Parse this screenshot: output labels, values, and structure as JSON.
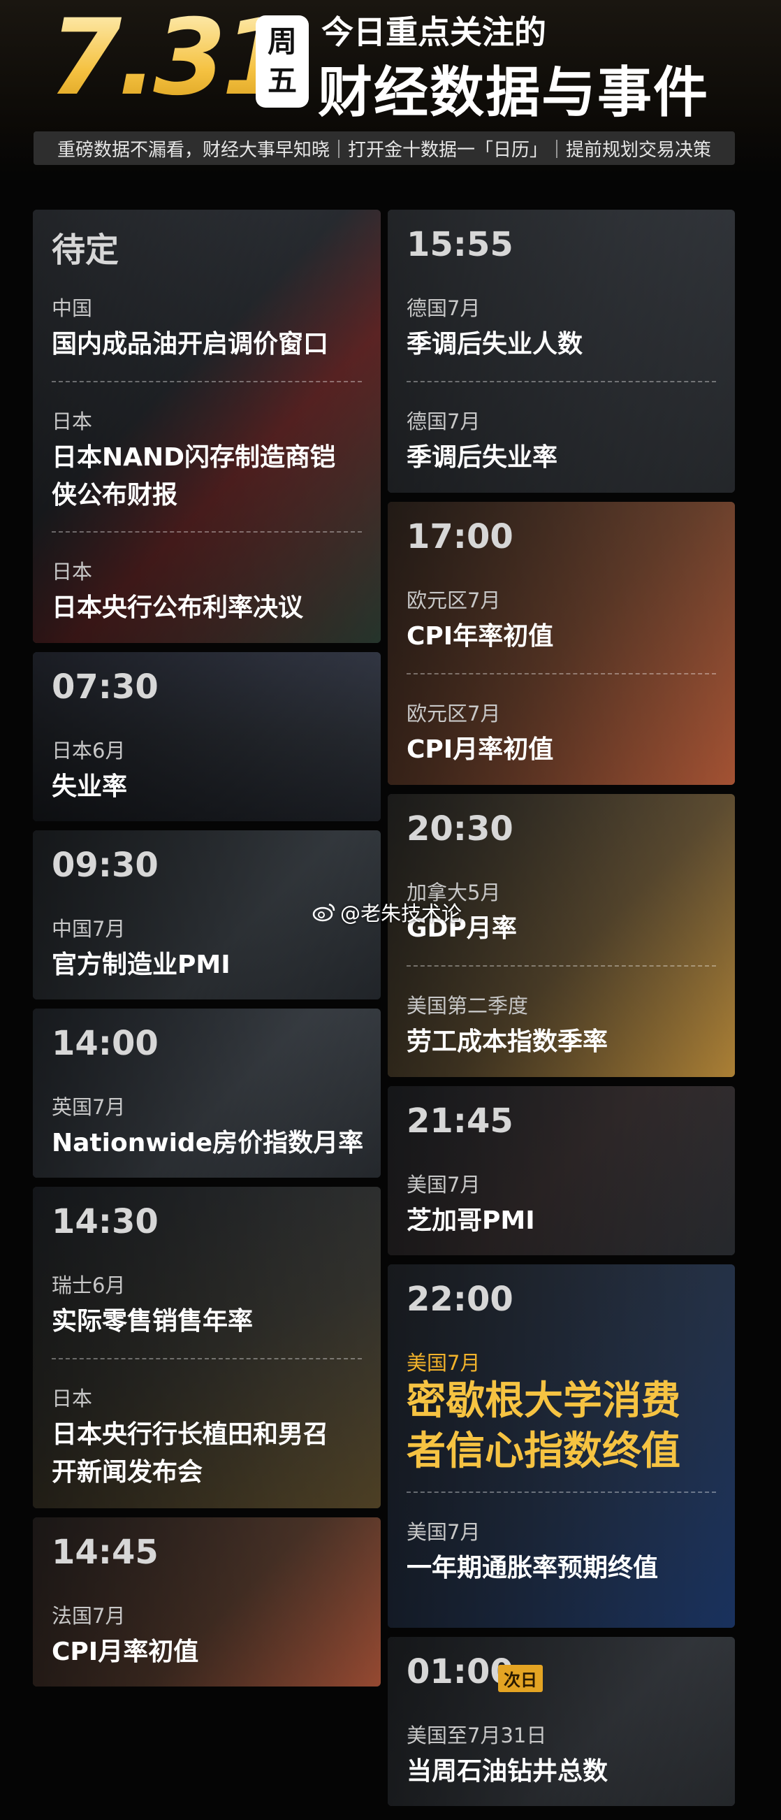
{
  "header": {
    "date": "7.31",
    "weekday": [
      "周",
      "五"
    ],
    "title_line1": "今日重点关注的",
    "title_line2": "财经数据与事件",
    "subtitle": "重磅数据不漏看，财经大事早知晓｜打开金十数据一「日历」｜提前规划交易决策"
  },
  "left": [
    {
      "time": "待定",
      "items": [
        {
          "region": "中国",
          "event": [
            "国内成品油开启调价窗口"
          ]
        },
        {
          "region": "日本",
          "event": [
            "日本NAND闪存制造商铠",
            "侠公布财报"
          ]
        },
        {
          "region": "日本",
          "event": [
            "日本央行公布利率决议"
          ]
        }
      ]
    },
    {
      "time": "07:30",
      "items": [
        {
          "region": "日本6月",
          "event": [
            "失业率"
          ]
        }
      ]
    },
    {
      "time": "09:30",
      "items": [
        {
          "region": "中国7月",
          "event": [
            "官方制造业PMI"
          ]
        }
      ]
    },
    {
      "time": "14:00",
      "items": [
        {
          "region": "英国7月",
          "event": [
            "Nationwide房价指数月率"
          ]
        }
      ]
    },
    {
      "time": "14:30",
      "items": [
        {
          "region": "瑞士6月",
          "event": [
            "实际零售销售年率"
          ]
        },
        {
          "region": "日本",
          "event": [
            "日本央行行长植田和男召",
            "开新闻发布会"
          ]
        }
      ]
    },
    {
      "time": "14:45",
      "items": [
        {
          "region": "法国7月",
          "event": [
            "CPI月率初值"
          ]
        }
      ]
    }
  ],
  "right": [
    {
      "time": "15:55",
      "items": [
        {
          "region": "德国7月",
          "event": [
            "季调后失业人数"
          ]
        },
        {
          "region": "德国7月",
          "event": [
            "季调后失业率"
          ]
        }
      ]
    },
    {
      "time": "17:00",
      "items": [
        {
          "region": "欧元区7月",
          "event": [
            "CPI年率初值"
          ]
        },
        {
          "region": "欧元区7月",
          "event": [
            "CPI月率初值"
          ]
        }
      ]
    },
    {
      "time": "20:30",
      "items": [
        {
          "region": "加拿大5月",
          "event": [
            "GDP月率"
          ]
        },
        {
          "region": "美国第二季度",
          "event": [
            "劳工成本指数季率"
          ]
        }
      ]
    },
    {
      "time": "21:45",
      "items": [
        {
          "region": "美国7月",
          "event": [
            "芝加哥PMI"
          ]
        }
      ]
    },
    {
      "time": "22:00",
      "items": [
        {
          "region": "美国7月",
          "event": [
            "密歇根大学消费",
            "者信心指数终值"
          ]
        },
        {
          "region": "美国7月",
          "event": [
            "一年期通胀率预期终值"
          ]
        }
      ]
    },
    {
      "time": "01:00",
      "tag": "次日",
      "items": [
        {
          "region": "美国至7月31日",
          "event": [
            "当周石油钻井总数"
          ]
        }
      ]
    }
  ],
  "watermark": "@老朱技术论",
  "colors": {
    "gold": "#f1b22b",
    "tag_bg": "#e4a423",
    "bg": "#050505"
  }
}
